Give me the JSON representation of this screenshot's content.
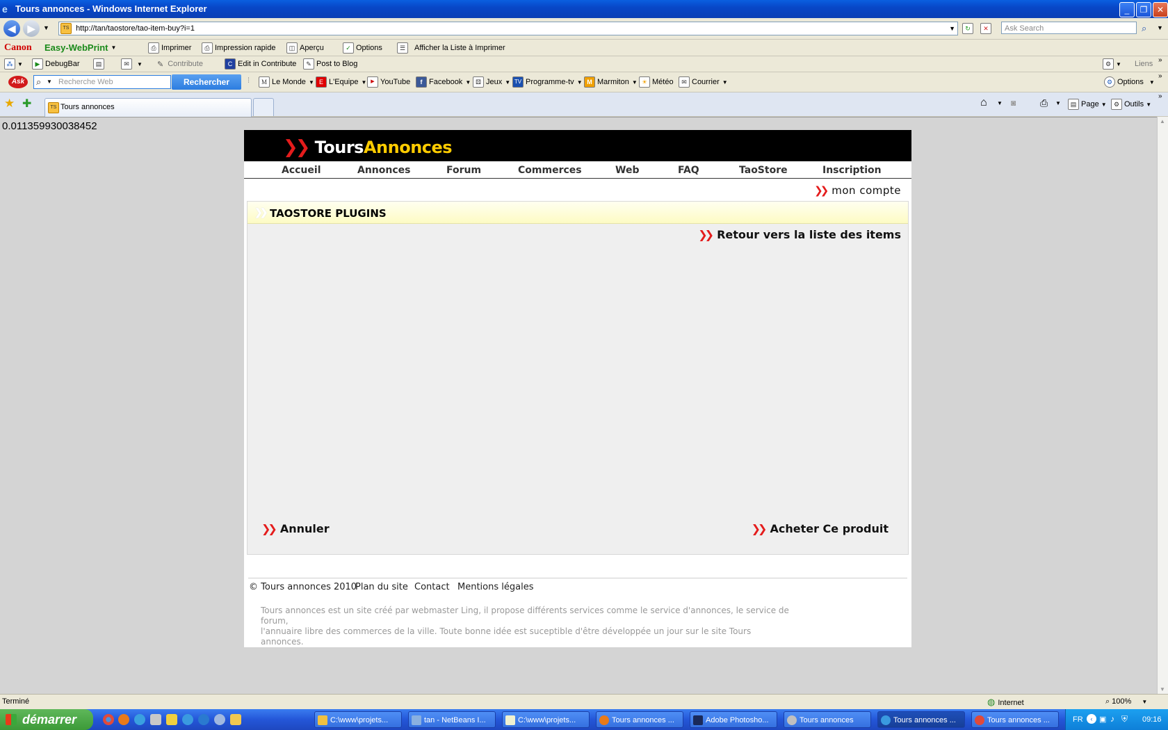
{
  "window": {
    "title": "Tours annonces - Windows Internet Explorer"
  },
  "browser": {
    "url": "http://tan/taostore/tao-item-buy?i=1",
    "search_placeholder": "Ask Search"
  },
  "canon_bar": {
    "brand": "Canon",
    "product": "Easy-WebPrint",
    "items": [
      "Imprimer",
      "Impression rapide",
      "Aperçu",
      "Options",
      "Afficher la Liste à Imprimer"
    ]
  },
  "links_bar": {
    "items": [
      "DebugBar",
      "Contribute",
      "Edit in Contribute",
      "Post to Blog"
    ],
    "right_label": "Liens"
  },
  "ask_bar": {
    "placeholder": "Recherche Web",
    "search_button": "Rechercher",
    "links": [
      "Le Monde",
      "L'Equipe",
      "YouTube",
      "Facebook",
      "Jeux",
      "Programme-tv",
      "Marmiton",
      "Météo",
      "Courrier"
    ],
    "options_label": "Options"
  },
  "tabs": {
    "active": "Tours annonces",
    "page_menu": "Page",
    "tools_menu": "Outils"
  },
  "page_debug": "0.011359930038452",
  "site": {
    "logo_white": "Tours",
    "logo_yellow": "Annonces",
    "menu": [
      "Accueil",
      "Annonces",
      "Forum",
      "Commerces",
      "Web",
      "FAQ",
      "TaoStore",
      "Inscription"
    ],
    "account_link": "mon compte",
    "panel_title": "TAOSTORE PLUGINS",
    "back_link": "Retour vers la liste des items",
    "cancel_link": "Annuler",
    "buy_link": "Acheter Ce produit",
    "footer": {
      "copyright": "© Tours annonces 2010",
      "links": [
        "Plan du site",
        "Contact",
        "Mentions légales"
      ],
      "description_1": "Tours annonces est un site créé par webmaster Ling, il propose différents services comme le service d'annonces, le service de forum,",
      "description_2": "l'annuaire libre des commerces de la ville. Toute bonne idée est suceptible d'être développée un jour sur le site Tours annonces."
    }
  },
  "statusbar": {
    "status": "Terminé",
    "zone": "Internet",
    "zoom": "100%"
  },
  "taskbar": {
    "start": "démarrer",
    "tasks": [
      "C:\\www\\projets...",
      "tan - NetBeans I...",
      "C:\\www\\projets...",
      "Tours annonces ...",
      "Adobe Photosho...",
      "Tours annonces",
      "Tours annonces ...",
      "Tours annonces ..."
    ],
    "lang": "FR",
    "clock": "09:16"
  },
  "colors": {
    "accent_red": "#e41c1c",
    "logo_yellow": "#ffcc00",
    "panel_head": "#fdfbc4",
    "ask_button": "#2c7de0"
  }
}
